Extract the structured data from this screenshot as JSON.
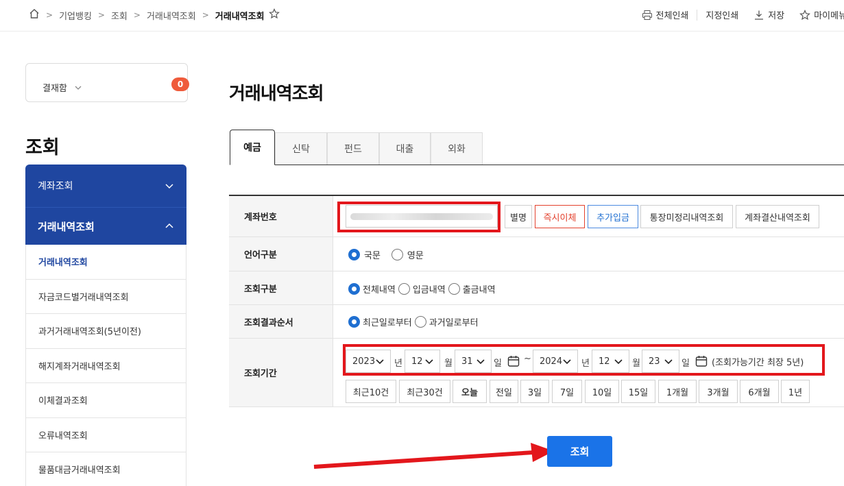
{
  "breadcrumb": {
    "items": [
      "기업뱅킹",
      "조회",
      "거래내역조회"
    ],
    "current": "거래내역조회"
  },
  "toolbar": {
    "print_all": "전체인쇄",
    "print_selected": "지정인쇄",
    "save": "저장",
    "my_menu": "마이메뉴"
  },
  "approval": {
    "label": "결재함",
    "count": "0"
  },
  "sidebar": {
    "title": "조회",
    "groups": [
      {
        "label": "계좌조회",
        "expanded": false
      },
      {
        "label": "거래내역조회",
        "expanded": true
      }
    ],
    "items": [
      {
        "label": "거래내역조회",
        "active": true
      },
      {
        "label": "자금코드별거래내역조회"
      },
      {
        "label": "과거거래내역조회(5년이전)"
      },
      {
        "label": "해지계좌거래내역조회"
      },
      {
        "label": "이체결과조회"
      },
      {
        "label": "오류내역조회"
      },
      {
        "label": "물품대금거래내역조회"
      }
    ]
  },
  "main": {
    "title": "거래내역조회",
    "tabs": [
      "예금",
      "신탁",
      "펀드",
      "대출",
      "외화"
    ],
    "active_tab": "예금"
  },
  "form": {
    "account": {
      "label": "계좌번호",
      "buttons": [
        "별명",
        "즉시이체",
        "추가입금",
        "통장미정리내역조회",
        "계좌결산내역조회"
      ]
    },
    "language": {
      "label": "언어구분",
      "options": [
        "국문",
        "영문"
      ],
      "selected": "국문"
    },
    "query_type": {
      "label": "조회구분",
      "options": [
        "전체내역",
        "입금내역",
        "출금내역"
      ],
      "selected": "전체내역"
    },
    "order": {
      "label": "조회결과순서",
      "options": [
        "최근일로부터",
        "과거일로부터"
      ],
      "selected": "최근일로부터"
    },
    "period": {
      "label": "조회기간",
      "from": {
        "year": "2023",
        "month": "12",
        "day": "31"
      },
      "to": {
        "year": "2024",
        "month": "12",
        "day": "23"
      },
      "units": {
        "year": "년",
        "month": "월",
        "day": "일"
      },
      "tilde": "~",
      "note": "(조회가능기간 최장 5년)",
      "quick": [
        "최근10건",
        "최근30건",
        "오늘",
        "전일",
        "3일",
        "7일",
        "10일",
        "15일",
        "1개월",
        "3개월",
        "6개월",
        "1년"
      ]
    }
  },
  "search_button": "조회",
  "colors": {
    "primary": "#1a73e8",
    "sidebar": "#1f46a0",
    "highlight": "#e3171c",
    "badge": "#ef5b3b"
  }
}
